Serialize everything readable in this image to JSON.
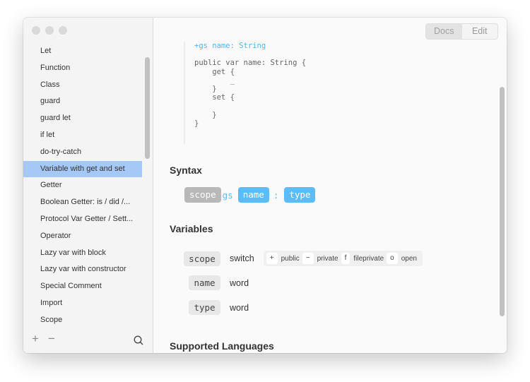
{
  "window": {
    "traffic_lights": [
      "close",
      "minimize",
      "zoom"
    ]
  },
  "sidebar": {
    "items": [
      {
        "label": "Let",
        "selected": false
      },
      {
        "label": "Function",
        "selected": false
      },
      {
        "label": "Class",
        "selected": false
      },
      {
        "label": "guard",
        "selected": false
      },
      {
        "label": "guard let",
        "selected": false
      },
      {
        "label": "if let",
        "selected": false
      },
      {
        "label": "do-try-catch",
        "selected": false
      },
      {
        "label": "Variable with get and set",
        "selected": true
      },
      {
        "label": "Getter",
        "selected": false
      },
      {
        "label": "Boolean Getter: is / did /...",
        "selected": false
      },
      {
        "label": "Protocol Var Getter / Sett...",
        "selected": false
      },
      {
        "label": "Operator",
        "selected": false
      },
      {
        "label": "Lazy var with block",
        "selected": false
      },
      {
        "label": "Lazy var with constructor",
        "selected": false
      },
      {
        "label": "Special Comment",
        "selected": false
      },
      {
        "label": "Import",
        "selected": false
      },
      {
        "label": "Scope",
        "selected": false
      }
    ],
    "footer": {
      "add_label": "+",
      "remove_label": "−",
      "search_icon": "search-icon"
    }
  },
  "toolbar": {
    "segments": [
      {
        "label": "Docs",
        "active": true
      },
      {
        "label": "Edit",
        "active": false
      }
    ]
  },
  "code_block": {
    "header": "+gs name: String",
    "lines": [
      "public var name: String {",
      "    get {",
      "        _",
      "    }",
      "    set {",
      "",
      "    }",
      "}"
    ]
  },
  "syntax": {
    "heading": "Syntax",
    "tokens": [
      {
        "text": "scope",
        "kind": "gray"
      },
      {
        "text": "gs",
        "kind": "plain"
      },
      {
        "text": "name",
        "kind": "blue"
      },
      {
        "text": ":",
        "kind": "plain"
      },
      {
        "text": "type",
        "kind": "blue"
      }
    ]
  },
  "variables": {
    "heading": "Variables",
    "rows": [
      {
        "key": "scope",
        "type": "switch",
        "options": [
          {
            "symbol": "+",
            "label": "public"
          },
          {
            "symbol": "−",
            "label": "private"
          },
          {
            "symbol": "f",
            "label": "fileprivate"
          },
          {
            "symbol": "o",
            "label": "open"
          }
        ]
      },
      {
        "key": "name",
        "type": "word"
      },
      {
        "key": "type",
        "type": "word"
      }
    ]
  },
  "supported_languages": {
    "heading": "Supported Languages"
  },
  "colors": {
    "accent_blue": "#5cbcf7",
    "selection": "#a6c8f7",
    "token_gray": "#b8b8b8"
  }
}
